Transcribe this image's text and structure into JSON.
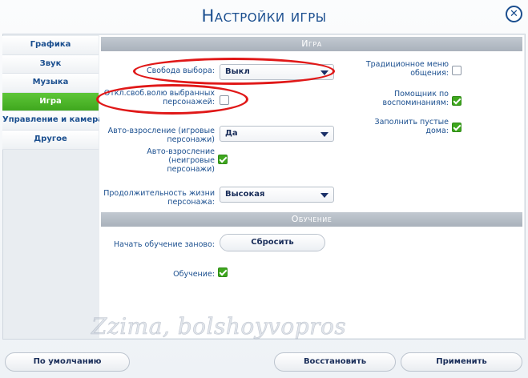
{
  "window": {
    "title": "Настройки игры",
    "close_icon": "close-icon"
  },
  "sidebar": {
    "items": [
      {
        "label": "Графика"
      },
      {
        "label": "Звук"
      },
      {
        "label": "Музыка"
      },
      {
        "label": "Игра",
        "active": true
      },
      {
        "label": "Управление и камера"
      },
      {
        "label": "Другое"
      }
    ]
  },
  "game_section": {
    "header": "Игра",
    "free_will": {
      "label": "Свобода выбора:",
      "value": "Выкл"
    },
    "disable_free_will_selected": {
      "label_line1": "Откл.своб.волю выбранных",
      "label_line2": "персонажей:",
      "checked": false
    },
    "auto_aging_played": {
      "label_line1": "Авто-взросление (игровые",
      "label_line2": "персонажи)",
      "value": "Да"
    },
    "auto_aging_unplayed": {
      "label_line1": "Авто-взросление (неигровые",
      "label_line2": "персонажи)",
      "checked": true
    },
    "lifespan": {
      "label_line1": "Продолжительность жизни",
      "label_line2": "персонажа:",
      "value": "Высокая"
    },
    "traditional_menu": {
      "label_line1": "Традиционное меню",
      "label_line2": "общения:",
      "checked": false
    },
    "memories_helper": {
      "label_line1": "Помощник по",
      "label_line2": "воспоминаниям:",
      "checked": true
    },
    "fill_empty_houses": {
      "label_line1": "Заполнить пустые",
      "label_line2": "дома:",
      "checked": true
    }
  },
  "tutorial_section": {
    "header": "Обучение",
    "restart": {
      "label": "Начать обучение заново:",
      "button": "Сбросить"
    },
    "tutorial": {
      "label": "Обучение:",
      "checked": true
    }
  },
  "watermark": "Zzima, bolshoyvopros",
  "footer": {
    "default_button": "По умолчанию",
    "restore_button": "Восстановить",
    "apply_button": "Применить"
  },
  "colors": {
    "accent_green": "#3fa71e",
    "title_blue": "#1b4f8f",
    "highlight_red": "#e01818"
  }
}
